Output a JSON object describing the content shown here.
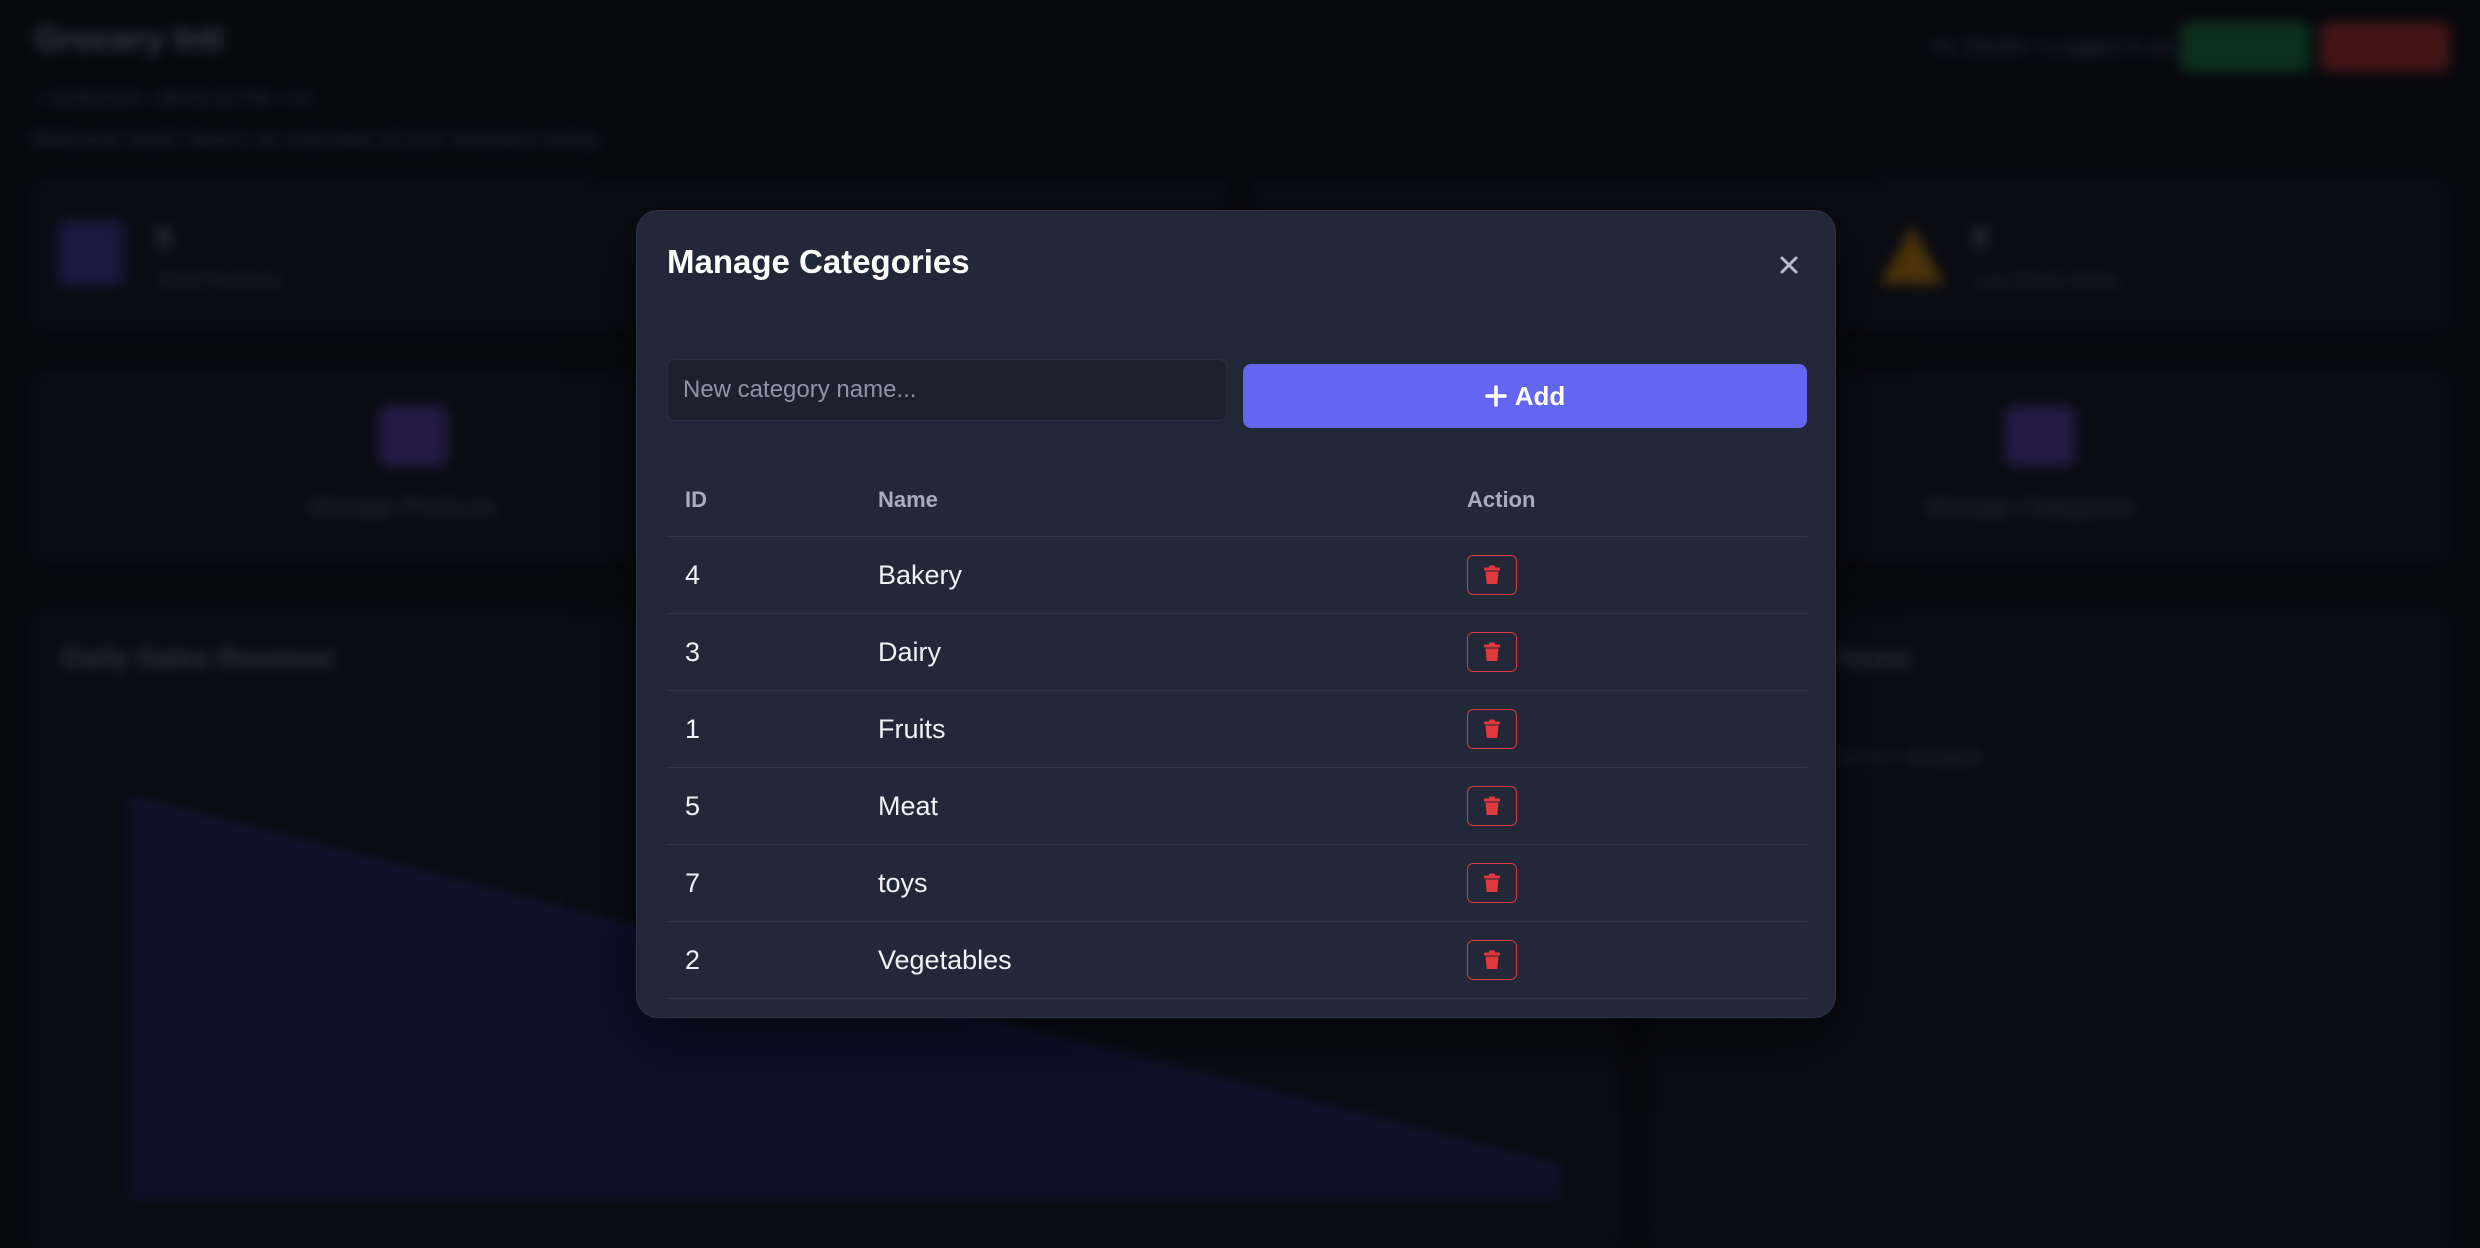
{
  "background": {
    "brand": "Grocery Inti",
    "date": "• 10/9/2025 • 08:05:45 PM • LK",
    "welcome": "Welcome back! Here's an overview of your business today.",
    "user": "Hi, Dinithi • Logged in as Admin",
    "stats": [
      {
        "value": "5",
        "label": "Total Products"
      },
      {
        "value": "0",
        "label": "Low Stock Items"
      }
    ],
    "actions": [
      {
        "label": "Manage Products"
      },
      {
        "label": "Manage Categories"
      }
    ],
    "chart_title": "Daily Sales Revenue",
    "side_title": "Items",
    "side_sub": "items stockpile"
  },
  "modal": {
    "title": "Manage Categories",
    "close_icon": "close-icon",
    "input_placeholder": "New category name...",
    "input_value": "",
    "add_label": "Add",
    "columns": {
      "id": "ID",
      "name": "Name",
      "action": "Action"
    },
    "rows": [
      {
        "id": "4",
        "name": "Bakery"
      },
      {
        "id": "3",
        "name": "Dairy"
      },
      {
        "id": "1",
        "name": "Fruits"
      },
      {
        "id": "5",
        "name": "Meat"
      },
      {
        "id": "7",
        "name": "toys"
      },
      {
        "id": "2",
        "name": "Vegetables"
      }
    ],
    "delete_icon": "trash-icon"
  },
  "colors": {
    "accent": "#6366f1",
    "danger": "#d9393d",
    "modal_bg": "#232838",
    "page_bg": "#0c0e15"
  }
}
